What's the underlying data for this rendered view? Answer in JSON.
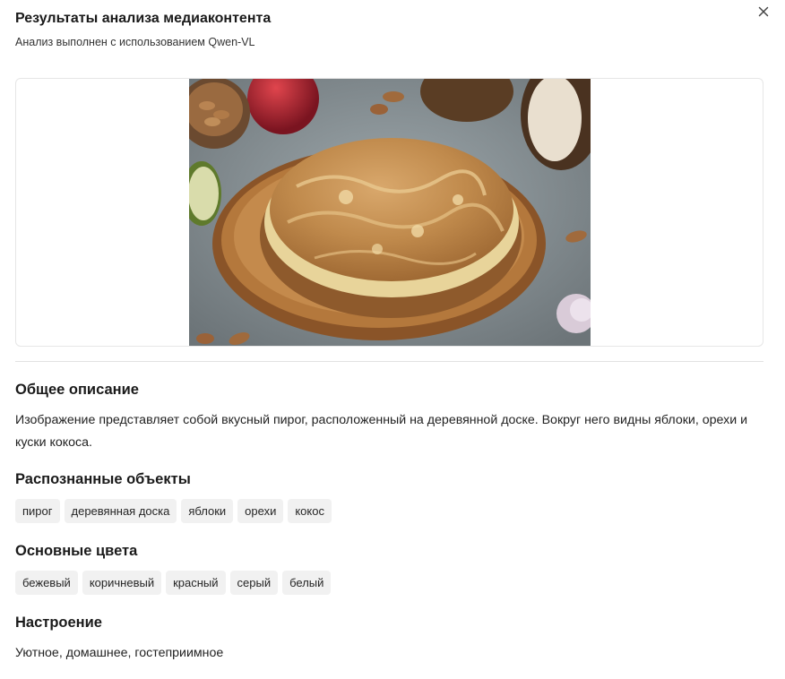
{
  "header": {
    "title": "Результаты анализа медиаконтента",
    "subtitle": "Анализ выполнен с использованием Qwen-VL"
  },
  "image": {
    "subject": "pie on wooden board with apples, almonds and coconut"
  },
  "sections": {
    "description": {
      "title": "Общее описание",
      "text": "Изображение представляет собой вкусный пирог, расположенный на деревянной доске. Вокруг него видны яблоки, орехи и куски кокоса."
    },
    "objects": {
      "title": "Распознанные объекты",
      "items": [
        "пирог",
        "деревянная доска",
        "яблоки",
        "орехи",
        "кокос"
      ]
    },
    "colors": {
      "title": "Основные цвета",
      "items": [
        "бежевый",
        "коричневый",
        "красный",
        "серый",
        "белый"
      ]
    },
    "mood": {
      "title": "Настроение",
      "text": "Уютное, домашнее, гостеприимное"
    }
  },
  "icons": {
    "close": "close-icon"
  }
}
